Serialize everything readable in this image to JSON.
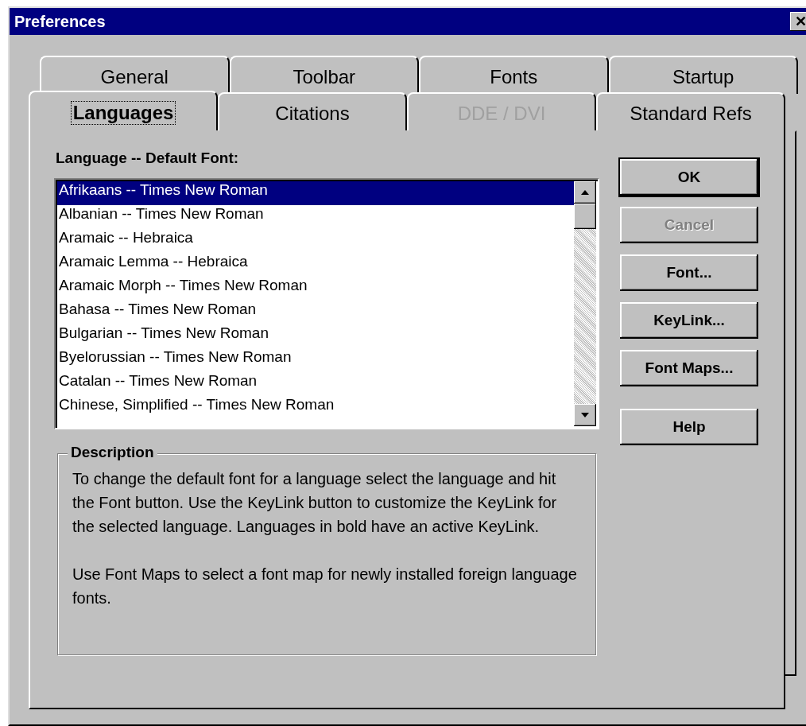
{
  "window": {
    "title": "Preferences",
    "close": "✕"
  },
  "tab_rows": [
    [
      {
        "label": "General",
        "selected": false,
        "disabled": false
      },
      {
        "label": "Toolbar",
        "selected": false,
        "disabled": false
      },
      {
        "label": "Fonts",
        "selected": false,
        "disabled": false
      },
      {
        "label": "Startup",
        "selected": false,
        "disabled": false
      }
    ],
    [
      {
        "label": "Languages",
        "selected": true,
        "disabled": false
      },
      {
        "label": "Citations",
        "selected": false,
        "disabled": false
      },
      {
        "label": "DDE / DVI",
        "selected": false,
        "disabled": true
      },
      {
        "label": "Standard Refs",
        "selected": false,
        "disabled": false
      }
    ]
  ],
  "list": {
    "label": "Language -- Default Font:",
    "items": [
      {
        "text": "Afrikaans -- Times New Roman",
        "selected": true
      },
      {
        "text": "Albanian -- Times New Roman",
        "selected": false
      },
      {
        "text": "Aramaic -- Hebraica",
        "selected": false
      },
      {
        "text": "Aramaic Lemma -- Hebraica",
        "selected": false
      },
      {
        "text": "Aramaic Morph -- Times New Roman",
        "selected": false
      },
      {
        "text": "Bahasa -- Times New Roman",
        "selected": false
      },
      {
        "text": "Bulgarian -- Times New Roman",
        "selected": false
      },
      {
        "text": "Byelorussian -- Times New Roman",
        "selected": false
      },
      {
        "text": "Catalan -- Times New Roman",
        "selected": false
      },
      {
        "text": "Chinese, Simplified -- Times New Roman",
        "selected": false
      }
    ]
  },
  "buttons": [
    {
      "label": "OK",
      "default": true,
      "disabled": false
    },
    {
      "label": "Cancel",
      "default": false,
      "disabled": true
    },
    {
      "label": "Font...",
      "default": false,
      "disabled": false
    },
    {
      "label": "KeyLink...",
      "default": false,
      "disabled": false
    },
    {
      "label": "Font Maps...",
      "default": false,
      "disabled": false
    },
    {
      "label": "Help",
      "default": false,
      "disabled": false
    }
  ],
  "description": {
    "title": "Description",
    "paragraphs": [
      "To change the default font for a language select the language and hit the Font button. Use the KeyLink button to customize the KeyLink for the selected language. Languages in bold have an active KeyLink.",
      "Use Font Maps to select a font map for newly installed foreign language fonts."
    ]
  }
}
